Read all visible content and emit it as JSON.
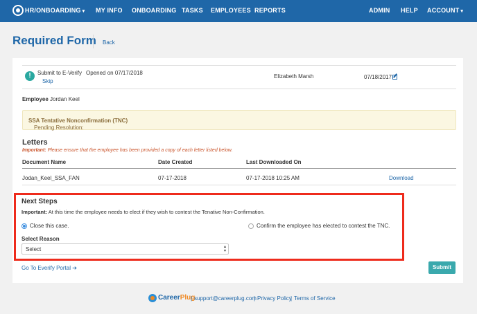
{
  "nav": {
    "brand": "HR/ONBOARDING",
    "brand_caret": "▾",
    "items": [
      "MY INFO",
      "ONBOARDING",
      "TASKS",
      "EMPLOYEES",
      "REPORTS"
    ],
    "right": [
      "ADMIN",
      "HELP"
    ],
    "account": "ACCOUNT",
    "account_caret": "▾"
  },
  "page": {
    "title": "Required Form",
    "back": "Back"
  },
  "everify": {
    "alert_glyph": "!",
    "label": "Submit to E-Verify",
    "skip": "Skip",
    "opened": "Opened on 07/17/2018",
    "assignee": "Elizabeth Marsh",
    "due_date": "07/18/2017"
  },
  "employee": {
    "label": "Employee",
    "name": "Jordan Keel"
  },
  "pending": {
    "label": "Pending Resolution:",
    "value": "SSA Tentative Nonconfirmation (TNC)"
  },
  "letters": {
    "title": "Letters",
    "important_label": "Important:",
    "important_text": "Please ensure that the employee has been provided a copy of each letter listed below.",
    "columns": [
      "Document Name",
      "Date Created",
      "Last Downloaded On"
    ],
    "rows": [
      {
        "name": "Jodan_Keel_SSA_FAN",
        "created": "07-17-2018",
        "downloaded": "07-17-2018 10:25 AM",
        "action": "Download"
      }
    ]
  },
  "next_steps": {
    "title": "Next Steps",
    "important_label": "Important:",
    "important_text": "At this time the employee needs to elect if they wish to contest the Tenative Non-Confirmation.",
    "option_close": "Close this case.",
    "option_contest": "Confirm the employee has elected to contest the TNC.",
    "reason_label": "Select Reason",
    "reason_value": "Select"
  },
  "portal_link": "Go To Everify Portal",
  "portal_arrow": "➔",
  "submit": "Submit",
  "footer": {
    "brand_career": "Career",
    "brand_plug": "Plug",
    "sep": "|",
    "email": "support@careerplug.com",
    "privacy": "Privacy Policy",
    "terms": "Terms of Service"
  },
  "colors": {
    "nav": "#1f67a8",
    "accent_teal": "#3aa9ad",
    "highlight_red": "#ee2b1c",
    "warning_bg": "#fbf7e2"
  }
}
